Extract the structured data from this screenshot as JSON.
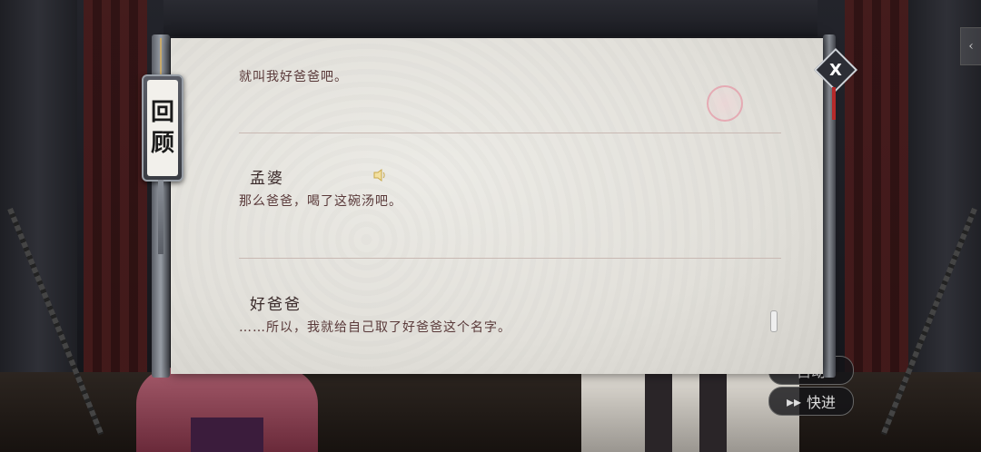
{
  "review_panel": {
    "title_chars": [
      "回",
      "顾"
    ],
    "entries": [
      {
        "speaker": "",
        "text": "就叫我好爸爸吧。"
      },
      {
        "speaker": "孟婆",
        "text": "那么爸爸，喝了这碗汤吧。"
      },
      {
        "speaker": "好爸爸",
        "text": "……所以，我就给自己取了好爸爸这个名字。"
      }
    ],
    "close_label": "X"
  },
  "game_controls": {
    "auto_label": "自动",
    "skip_label": "快进",
    "skip_icon": "fast-forward-icon"
  },
  "colors": {
    "panel_bg": "#e6e4de",
    "text": "#5a3a3a",
    "accent_red": "#b52a2a"
  }
}
